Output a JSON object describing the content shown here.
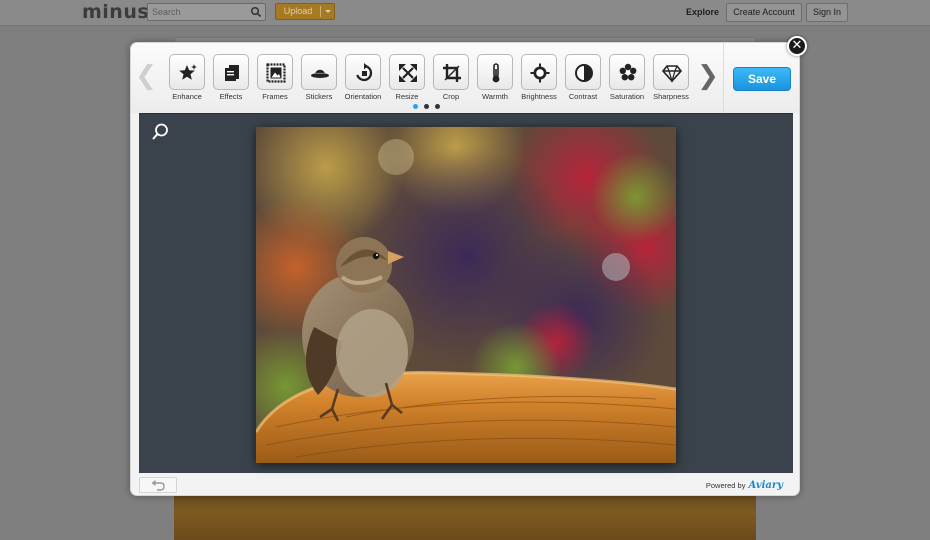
{
  "site": {
    "logo": "minus",
    "search_placeholder": "Search",
    "upload_label": "Upload",
    "nav": {
      "explore": "Explore",
      "create_account": "Create Account",
      "sign_in": "Sign In"
    }
  },
  "editor": {
    "tools": [
      {
        "label": "Enhance",
        "icon": "star-sparkle-icon"
      },
      {
        "label": "Effects",
        "icon": "effects-icon"
      },
      {
        "label": "Frames",
        "icon": "frame-icon"
      },
      {
        "label": "Stickers",
        "icon": "hat-icon"
      },
      {
        "label": "Orientation",
        "icon": "rotate-icon"
      },
      {
        "label": "Resize",
        "icon": "resize-icon"
      },
      {
        "label": "Crop",
        "icon": "crop-icon"
      },
      {
        "label": "Warmth",
        "icon": "thermometer-icon"
      },
      {
        "label": "Brightness",
        "icon": "sun-icon"
      },
      {
        "label": "Contrast",
        "icon": "contrast-icon"
      },
      {
        "label": "Saturation",
        "icon": "saturation-icon"
      },
      {
        "label": "Sharpness",
        "icon": "diamond-icon"
      }
    ],
    "save_label": "Save",
    "pager": {
      "count": 3,
      "active_index": 0
    },
    "powered_by": "Powered by",
    "brand": "Aviary",
    "colors": {
      "save_button": "#1a93de",
      "canvas_background": "#3a434b",
      "active_dot": "#2aa4e8"
    }
  }
}
